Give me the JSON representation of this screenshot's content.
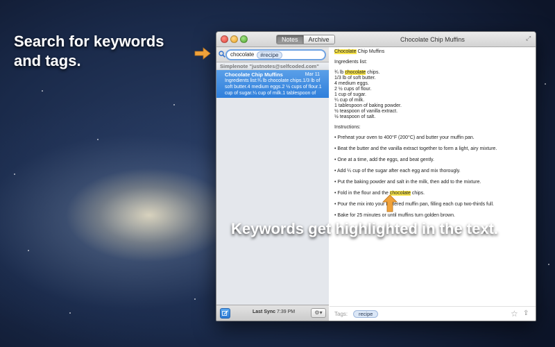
{
  "promo": {
    "search_text": "Search for keywords and tags.",
    "highlight_text": "Keywords get highlighted in the text."
  },
  "window": {
    "tabs": [
      {
        "label": "Notes",
        "active": true
      },
      {
        "label": "Archive",
        "active": false
      }
    ],
    "note_title": "Chocolate Chip Muffins"
  },
  "search": {
    "query": "chocolate",
    "tag": "#recipe"
  },
  "sidebar": {
    "account": "Simplenote \"justnotes@selfcoded.com\"",
    "notes": [
      {
        "title": "Chocolate Chip Muffins",
        "date": "Mar 11",
        "preview": "Ingredients list:¾ lb chocolate chips.1/3 lb of soft butter.4 medium eggs.2 ½ cups of flour.1 cup of sugar.¼ cup of milk.1 tablespoon of"
      }
    ],
    "sync_label": "Last Sync",
    "sync_time": "7:39 PM"
  },
  "editor": {
    "title_highlight": "Chocolate",
    "title_rest": " Chip Muffins",
    "ingredients_heading": "Ingredients list:",
    "ing1_pre": "¾ lb ",
    "ing1_hl": "chocolate",
    "ing1_post": " chips.",
    "ingredients": [
      "1/3 lb of soft butter.",
      "4 medium eggs.",
      "2 ½ cups of flour.",
      "1 cup of sugar.",
      "¼ cup of milk.",
      "1 tablespoon of baking powder.",
      "½ teaspoon of vanilla extract.",
      "½ teaspoon of salt."
    ],
    "instructions_heading": "Instructions:",
    "steps": [
      "Preheat your oven to 400°F (200°C) and butter your muffin pan.",
      "Beat the butter and the vanilla extract together to form a light, airy mixture.",
      "One at a time, add the eggs, and beat gently.",
      "Add ¼ cup of the sugar after each egg and mix thorougly.",
      "Put the baking powder and salt in the milk, then add to the mixture."
    ],
    "step6_pre": "Fold in the flour and the ",
    "step6_hl": "chocolate",
    "step6_post": " chips.",
    "step7": "Pour the mix into your buttered muffin pan, filling each cup two-thirds full.",
    "step8": "Bake for 25 minutes or until muffins turn golden brown."
  },
  "tags": {
    "label": "Tags:",
    "items": [
      "recipe"
    ]
  },
  "colors": {
    "highlight": "#f9e54c",
    "selection": "#3a86dd",
    "arrow": "#f0a23a"
  },
  "icons": [
    "search-icon",
    "new-note-icon",
    "gear-icon",
    "star-icon",
    "share-icon",
    "resize-icon"
  ]
}
